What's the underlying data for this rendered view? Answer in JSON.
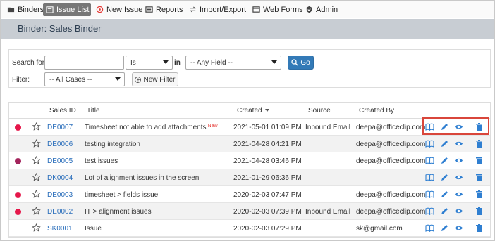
{
  "nav": {
    "items": [
      {
        "label": "Binders",
        "icon": "folder-icon"
      },
      {
        "label": "Issue List",
        "icon": "list-icon",
        "active": true
      },
      {
        "label": "New Issue",
        "icon": "target-icon"
      },
      {
        "label": "Reports",
        "icon": "reports-icon"
      },
      {
        "label": "Import/Export",
        "icon": "import-export-icon"
      },
      {
        "label": "Web Forms",
        "icon": "web-forms-icon"
      },
      {
        "label": "Admin",
        "icon": "shield-check-icon"
      }
    ]
  },
  "banner": {
    "title": "Binder: Sales Binder"
  },
  "search": {
    "search_for_label": "Search for:",
    "search_value": "",
    "operator": "Is",
    "in_label": "in",
    "field": "-- Any Field --",
    "go_label": "Go",
    "filter_label": "Filter:",
    "filter_value": "-- All Cases --",
    "new_filter_label": "New Filter"
  },
  "table": {
    "headers": {
      "id": "Sales ID",
      "title": "Title",
      "created": "Created",
      "source": "Source",
      "created_by": "Created By"
    },
    "rows": [
      {
        "id": "DE0007",
        "title": "Timesheet not able to add attachments",
        "new": "New",
        "created": "2021-05-01 01:09 PM",
        "source": "Inbound Email",
        "created_by": "deepa@officeclip.com",
        "dot": "#e5174a"
      },
      {
        "id": "DE0006",
        "title": "testing integration",
        "new": "",
        "created": "2021-04-28 04:21 PM",
        "source": "",
        "created_by": "deepa@officeclip.com",
        "dot": ""
      },
      {
        "id": "DE0005",
        "title": "test issues",
        "new": "",
        "created": "2021-04-28 03:46 PM",
        "source": "",
        "created_by": "deepa@officeclip.com",
        "dot": "#a3245c"
      },
      {
        "id": "DK0004",
        "title": "Lot of alignment issues in the screen",
        "new": "",
        "created": "2021-01-29 06:36 PM",
        "source": "",
        "created_by": "",
        "dot": ""
      },
      {
        "id": "DE0003",
        "title": "timesheet > fields issue",
        "new": "",
        "created": "2020-02-03 07:47 PM",
        "source": "",
        "created_by": "deepa@officeclip.com",
        "dot": "#e5174a"
      },
      {
        "id": "DE0002",
        "title": "IT > alignment issues",
        "new": "",
        "created": "2020-02-03 07:39 PM",
        "source": "Inbound Email",
        "created_by": "deepa@officeclip.com",
        "dot": "#e5174a"
      },
      {
        "id": "SK0001",
        "title": "Issue",
        "new": "",
        "created": "2020-02-03 07:29 PM",
        "source": "",
        "created_by": "sk@gmail.com",
        "dot": ""
      }
    ]
  },
  "colors": {
    "accent": "#337ab7",
    "link": "#2a6ebb",
    "highlight": "#d9463b"
  }
}
